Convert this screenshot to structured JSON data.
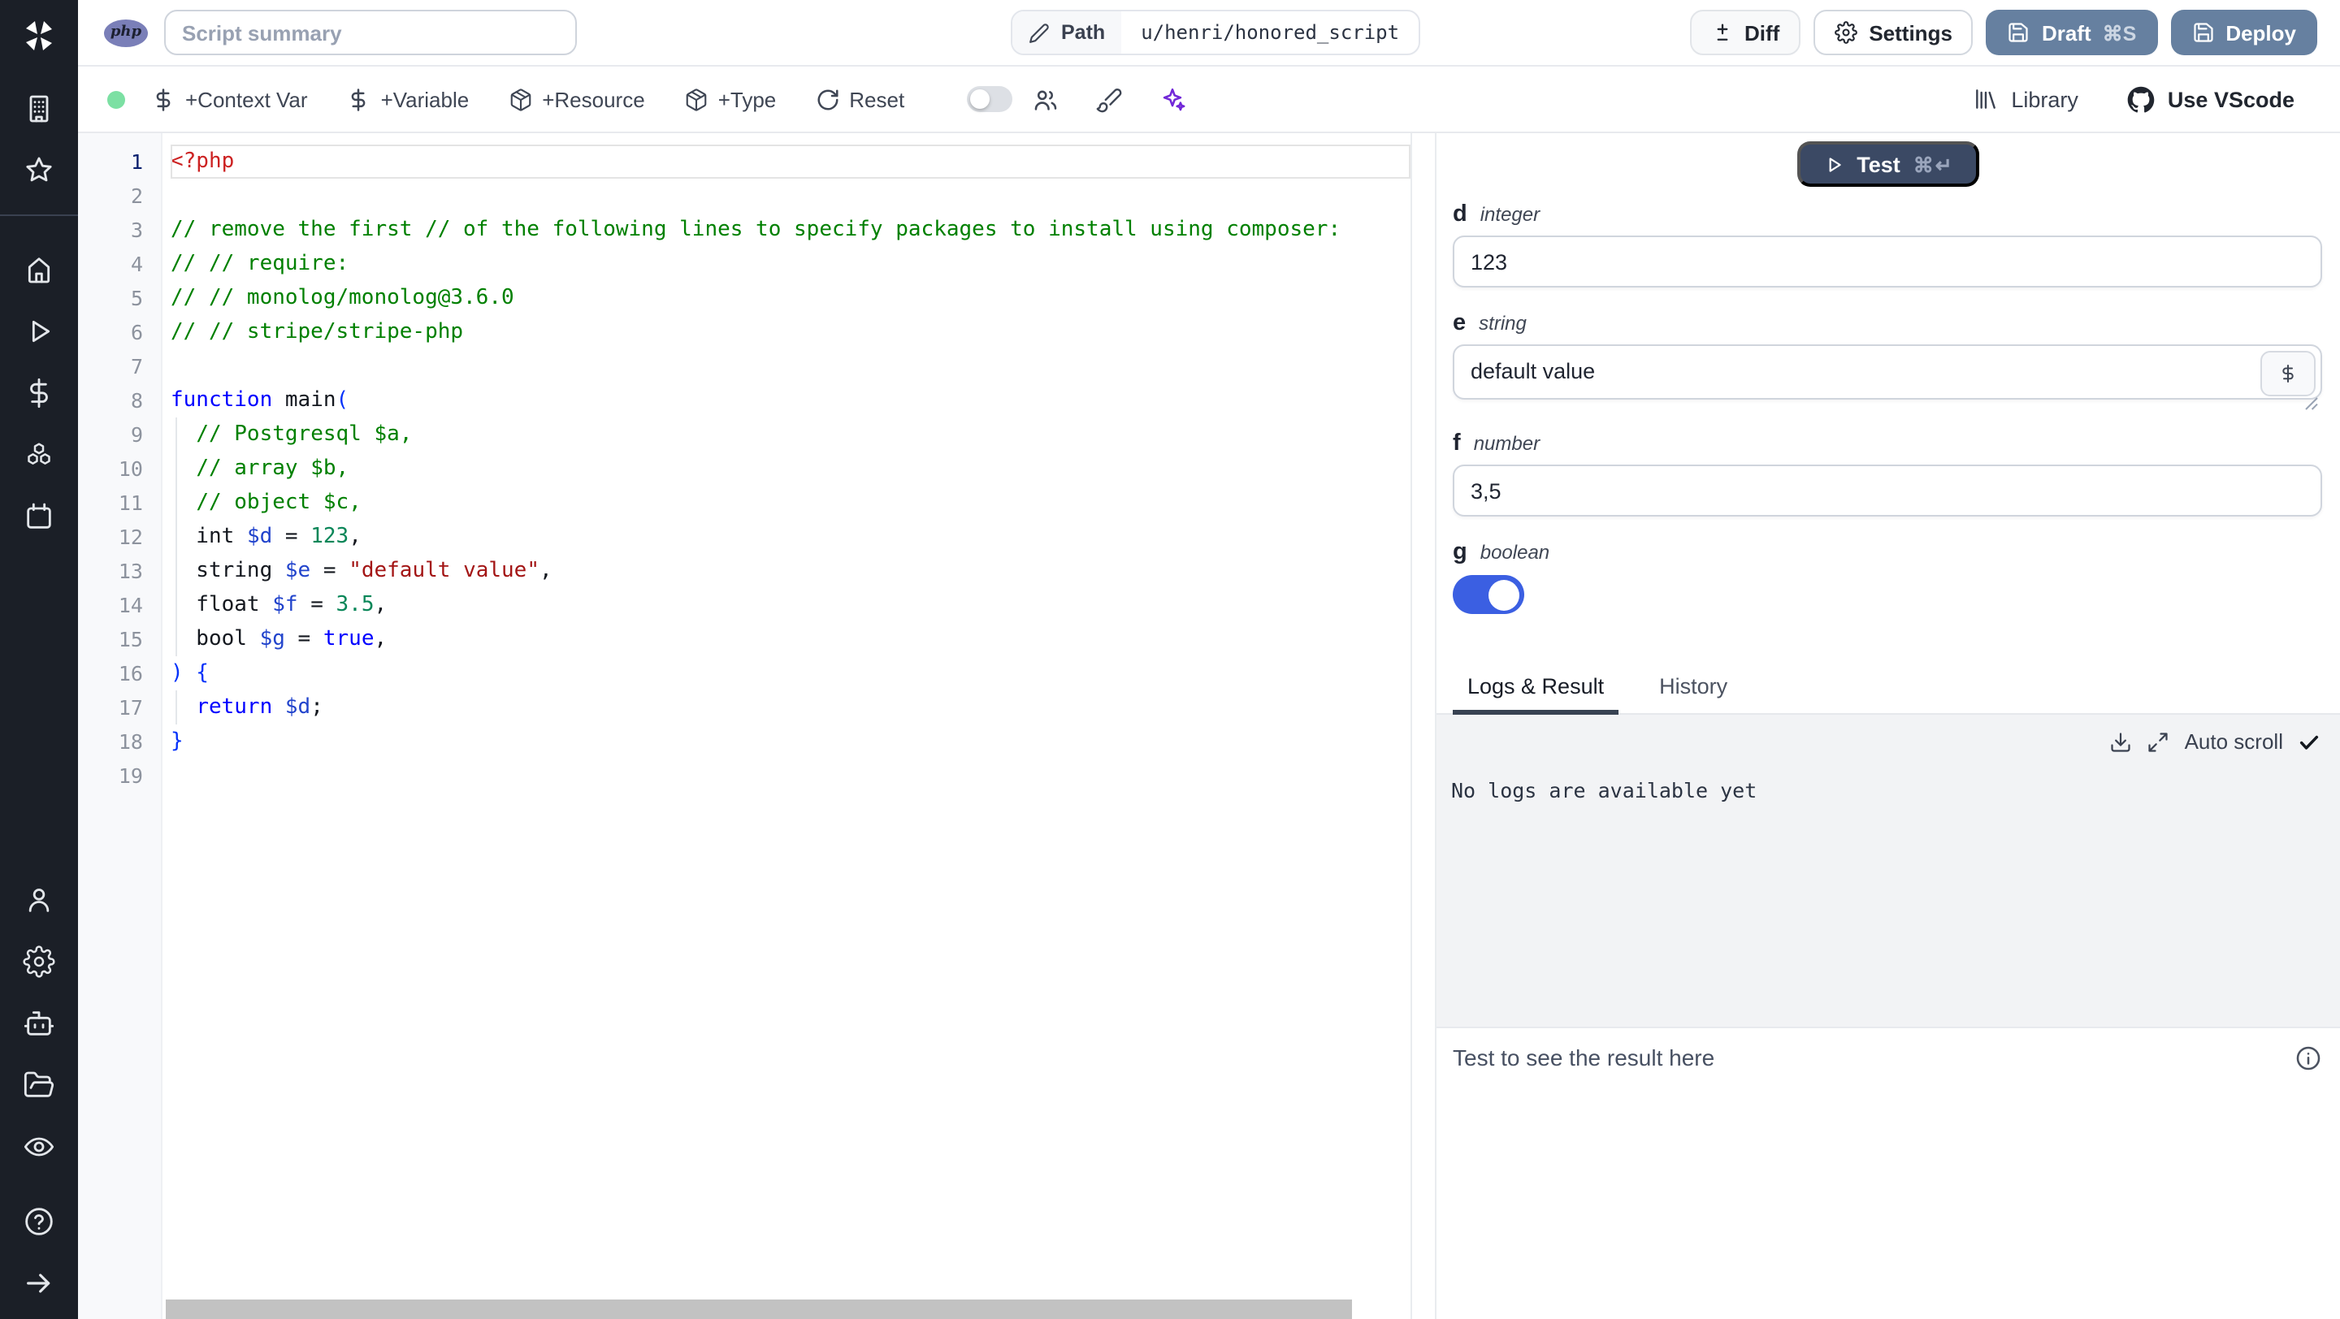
{
  "topbar": {
    "language_badge": "php",
    "summary_placeholder": "Script summary",
    "path_label": "Path",
    "path_value": "u/henri/honored_script",
    "diff_label": "Diff",
    "settings_label": "Settings",
    "draft_label": "Draft",
    "draft_shortcut": "⌘S",
    "deploy_label": "Deploy"
  },
  "toolbar": {
    "status": "connected",
    "actions": [
      {
        "icon": "dollar-icon",
        "label": "+Context Var"
      },
      {
        "icon": "dollar-icon",
        "label": "+Variable"
      },
      {
        "icon": "package-icon",
        "label": "+Resource"
      },
      {
        "icon": "package-icon",
        "label": "+Type"
      },
      {
        "icon": "rotate-icon",
        "label": "Reset"
      }
    ],
    "toggle_on": false,
    "library_label": "Library",
    "vscode_label": "Use VScode"
  },
  "sidebar": {
    "icons": [
      "windmill-logo",
      "building",
      "star",
      "home",
      "play",
      "dollar",
      "boxes",
      "calendar",
      "user",
      "settings",
      "bot",
      "folder-open",
      "eye",
      "help-circle",
      "arrow-right"
    ]
  },
  "editor": {
    "language": "php",
    "lines": [
      {
        "n": 1,
        "active": true,
        "tokens": [
          [
            "tag",
            "<?php"
          ]
        ]
      },
      {
        "n": 2,
        "tokens": []
      },
      {
        "n": 3,
        "tokens": [
          [
            "cmt",
            "// remove the first // of the following lines to specify packages to install using composer:"
          ]
        ]
      },
      {
        "n": 4,
        "tokens": [
          [
            "cmt",
            "// // require:"
          ]
        ]
      },
      {
        "n": 5,
        "tokens": [
          [
            "cmt",
            "// // monolog/monolog@3.6.0"
          ]
        ]
      },
      {
        "n": 6,
        "tokens": [
          [
            "cmt",
            "// // stripe/stripe-php"
          ]
        ]
      },
      {
        "n": 7,
        "tokens": []
      },
      {
        "n": 8,
        "tokens": [
          [
            "kw",
            "function"
          ],
          [
            "pln",
            " main"
          ],
          [
            "brk",
            "("
          ]
        ]
      },
      {
        "n": 9,
        "guide": true,
        "tokens": [
          [
            "pln",
            "  "
          ],
          [
            "cmt",
            "// Postgresql $a,"
          ]
        ]
      },
      {
        "n": 10,
        "guide": true,
        "tokens": [
          [
            "pln",
            "  "
          ],
          [
            "cmt",
            "// array $b,"
          ]
        ]
      },
      {
        "n": 11,
        "guide": true,
        "tokens": [
          [
            "pln",
            "  "
          ],
          [
            "cmt",
            "// object $c,"
          ]
        ]
      },
      {
        "n": 12,
        "guide": true,
        "tokens": [
          [
            "pln",
            "  int "
          ],
          [
            "var",
            "$d"
          ],
          [
            "pln",
            " = "
          ],
          [
            "num",
            "123"
          ],
          [
            "pln",
            ","
          ]
        ]
      },
      {
        "n": 13,
        "guide": true,
        "tokens": [
          [
            "pln",
            "  string "
          ],
          [
            "var",
            "$e"
          ],
          [
            "pln",
            " = "
          ],
          [
            "str",
            "\"default value\""
          ],
          [
            "pln",
            ","
          ]
        ]
      },
      {
        "n": 14,
        "guide": true,
        "tokens": [
          [
            "pln",
            "  float "
          ],
          [
            "var",
            "$f"
          ],
          [
            "pln",
            " = "
          ],
          [
            "num",
            "3.5"
          ],
          [
            "pln",
            ","
          ]
        ]
      },
      {
        "n": 15,
        "guide": true,
        "tokens": [
          [
            "pln",
            "  bool "
          ],
          [
            "var",
            "$g"
          ],
          [
            "pln",
            " = "
          ],
          [
            "kw",
            "true"
          ],
          [
            "pln",
            ","
          ]
        ]
      },
      {
        "n": 16,
        "tokens": [
          [
            "brk",
            ") {"
          ]
        ]
      },
      {
        "n": 17,
        "guide": true,
        "tokens": [
          [
            "pln",
            "  "
          ],
          [
            "kw",
            "return"
          ],
          [
            "pln",
            " "
          ],
          [
            "var",
            "$d"
          ],
          [
            "pln",
            ";"
          ]
        ]
      },
      {
        "n": 18,
        "tokens": [
          [
            "brk",
            "}"
          ]
        ]
      },
      {
        "n": 19,
        "tokens": []
      }
    ]
  },
  "right_panel": {
    "test_label": "Test",
    "test_shortcut": "⌘↵",
    "fields": [
      {
        "name": "d",
        "type": "integer",
        "value": "123",
        "widget": "input"
      },
      {
        "name": "e",
        "type": "string",
        "value": "default value",
        "widget": "textarea",
        "var_button": "$"
      },
      {
        "name": "f",
        "type": "number",
        "value": "3,5",
        "widget": "input"
      },
      {
        "name": "g",
        "type": "boolean",
        "value": true,
        "widget": "toggle"
      }
    ],
    "tabs": [
      {
        "label": "Logs & Result",
        "active": true
      },
      {
        "label": "History",
        "active": false
      }
    ],
    "autoscroll_label": "Auto scroll",
    "logs_empty_text": "No logs are available yet",
    "result_placeholder": "Test to see the result here"
  },
  "colors": {
    "sidebar_bg": "#1b1f27",
    "slate_button": "#6680a0",
    "test_button": "#3b4964",
    "toggle_on_blue": "#3b5fe2",
    "status_green": "#7ce0a3",
    "sparkles_purple": "#7228d8",
    "php_badge": "#7a7fb8",
    "comment_green": "#008000",
    "keyword_blue": "#0000ff",
    "string_red": "#a31515",
    "number_green": "#098658"
  }
}
